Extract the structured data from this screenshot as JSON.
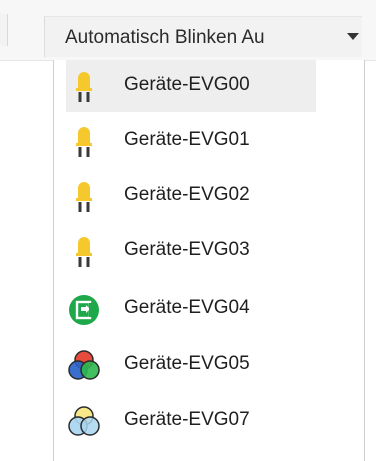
{
  "toolbar": {
    "dropdown_value": "Automatisch Blinken Au"
  },
  "devices": [
    {
      "label": "Geräte-EVG00",
      "icon": "yellow-bulb-icon",
      "selected": true
    },
    {
      "label": "Geräte-EVG01",
      "icon": "yellow-bulb-icon",
      "selected": false
    },
    {
      "label": "Geräte-EVG02",
      "icon": "yellow-bulb-icon",
      "selected": false
    },
    {
      "label": "Geräte-EVG03",
      "icon": "yellow-bulb-icon",
      "selected": false
    },
    {
      "label": "Geräte-EVG04",
      "icon": "green-exit-sign-icon",
      "selected": false
    },
    {
      "label": "Geräte-EVG05",
      "icon": "rgb-color-circles-icon",
      "selected": false
    },
    {
      "label": "Geräte-EVG07",
      "icon": "pastel-color-circles-icon",
      "selected": false
    }
  ],
  "colors": {
    "bulb_yellow": "#f5c82e",
    "bulb_base": "#3a3a3a",
    "exit_green": "#1fa84a",
    "rgb_red": "#e74b3c",
    "rgb_green": "#2eb84f",
    "rgb_blue": "#2a63c9",
    "pastel_yellow": "#f7e98a",
    "pastel_blue": "#a9d6f0"
  }
}
